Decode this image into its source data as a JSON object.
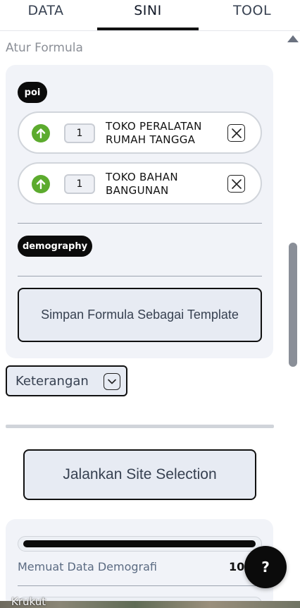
{
  "tabs": [
    {
      "label": "DATA"
    },
    {
      "label": "SINI"
    },
    {
      "label": "TOOL"
    }
  ],
  "active_tab": "SINI",
  "section_title": "Atur Formula",
  "formula": {
    "poi_tag": "poi",
    "poi_items": [
      {
        "weight": "1",
        "label": "TOKO PERALATAN RUMAH TANGGA",
        "direction_icon": "arrow-up-icon"
      },
      {
        "weight": "1",
        "label": "TOKO BAHAN BANGUNAN",
        "direction_icon": "arrow-up-icon"
      }
    ],
    "demography_tag": "demography",
    "save_template_label": "Simpan Formula Sebagai Template"
  },
  "keterangan_label": "Keterangan",
  "run_button_label": "Jalankan Site Selection",
  "status": {
    "label": "Memuat Data Demografi",
    "value": "100",
    "progress": 1.0
  },
  "map_label": "Krukut",
  "help_label": "?",
  "colors": {
    "accent_green": "#5cab2e",
    "dark": "#0b0b0b",
    "panel_bg": "#f1f3f8",
    "button_bg": "#e7ebf3"
  }
}
